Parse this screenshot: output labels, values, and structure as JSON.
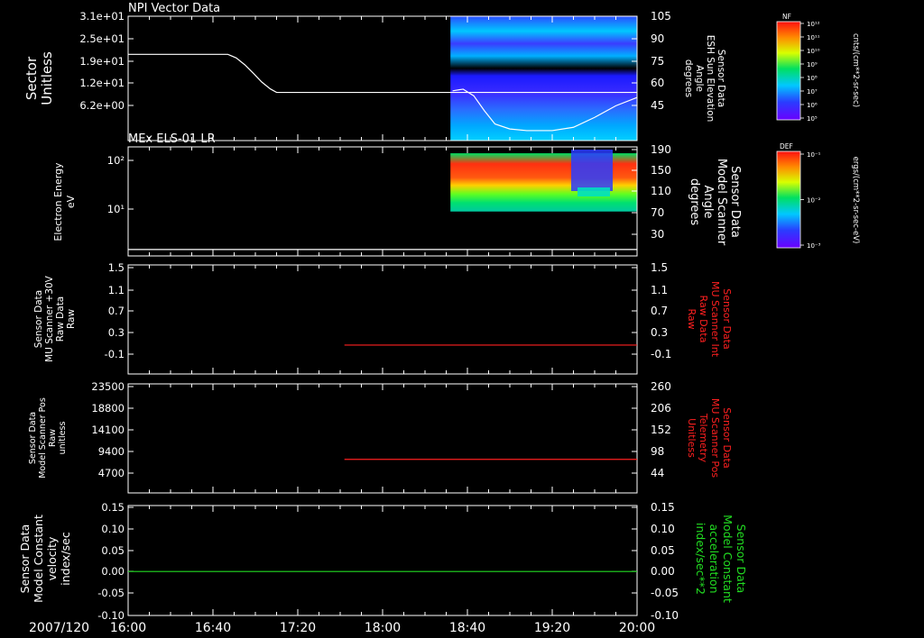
{
  "timeline": {
    "date": "2007/120",
    "ticks": [
      "16:00",
      "16:40",
      "17:20",
      "18:00",
      "18:40",
      "19:20",
      "20:00"
    ],
    "start_min": 960,
    "end_min": 1200
  },
  "colors": {
    "background": "#000000",
    "axis": "#ffffff",
    "red_trace": "#ff2020",
    "green_trace": "#22dd22"
  },
  "chart_data": [
    {
      "type": "line",
      "title": "NPI Vector Data",
      "ylabel": [
        "Sector",
        "Unitless"
      ],
      "yticks": [
        "3.1e+01",
        "2.5e+01",
        "1.9e+01",
        "1.2e+01",
        "6.2e+00"
      ],
      "ylim": [
        0,
        31
      ],
      "x": [
        960,
        1007,
        1011,
        1015,
        1019,
        1023,
        1027,
        1030,
        1200
      ],
      "y": [
        21.5,
        21.5,
        20.6,
        18.9,
        16.8,
        14.6,
        12.9,
        12.0,
        12.0
      ],
      "right_ylabel": [
        "Sensor Data",
        "ESH Sun Elevation",
        "Angle",
        "degrees"
      ],
      "right_yticks": [
        "105",
        "90",
        "75",
        "60",
        "45"
      ],
      "right_ylim": [
        30,
        105
      ],
      "right_series": {
        "x": [
          1113,
          1118,
          1123,
          1128,
          1133,
          1140,
          1148,
          1160,
          1170,
          1180,
          1190,
          1200
        ],
        "y": [
          60,
          61,
          57,
          48,
          40,
          37,
          36,
          36,
          38,
          44,
          51,
          56
        ]
      },
      "spectrogram_time_range": [
        1112,
        1200
      ],
      "color_scale": {
        "label": "NF",
        "units": "cnts/(cm**2-sr-sec)",
        "ticks": [
          "10¹²",
          "10¹¹",
          "10¹⁰",
          "10⁹",
          "10⁸",
          "10⁷",
          "10⁶",
          "10⁵"
        ]
      }
    },
    {
      "type": "line",
      "title": "MEx ELS-01 LR",
      "ylabel": [
        "Electron Energy",
        "eV"
      ],
      "yticks": [
        "10²",
        "10¹"
      ],
      "log_scale": true,
      "ylim": [
        1.5,
        200
      ],
      "x": [
        960,
        1200
      ],
      "y": [
        2.0,
        2.0
      ],
      "right_ylabel": [
        "Sensor Data",
        "Model Scanner",
        "Angle",
        "degrees"
      ],
      "right_yticks": [
        "190",
        "150",
        "110",
        "70",
        "30"
      ],
      "right_ylim": [
        8,
        190
      ],
      "spectrogram_time_range": [
        1112,
        1200
      ],
      "spectrogram_energy_range": [
        11,
        150
      ],
      "color_scale": {
        "label": "DEF",
        "units": "ergs/(cm**2-sr-sec-eV)",
        "ticks": [
          "10⁻¹",
          "10⁻²",
          "10⁻³"
        ]
      }
    },
    {
      "type": "line",
      "ylabel": [
        "Sensor Data",
        "MU Scanner +30V",
        "Raw Data",
        "Raw"
      ],
      "yticks": [
        "1.5",
        "1.1",
        "0.7",
        "0.3",
        "-0.1"
      ],
      "ylim": [
        -0.5,
        1.5
      ],
      "right_yticks": [
        "1.5",
        "1.1",
        "0.7",
        "0.3",
        "-0.1"
      ],
      "right_ylabel": [
        "Sensor Data",
        "MU Scanner Int",
        "Raw Data",
        "Raw"
      ],
      "series": [
        {
          "name": "Sensor Data MU Scanner Int Raw Data Raw",
          "color": "#ff2020",
          "x": [
            1062,
            1200
          ],
          "y": [
            0.03,
            0.03
          ]
        }
      ]
    },
    {
      "type": "line",
      "ylabel": [
        "Sensor Data",
        "Model Scanner Pos",
        "Raw",
        "unitless"
      ],
      "yticks": [
        "23500",
        "18800",
        "14100",
        "9400",
        "4700"
      ],
      "ylim": [
        0,
        23500
      ],
      "right_yticks": [
        "260",
        "206",
        "152",
        "98",
        "44"
      ],
      "right_ylabel": [
        "Sensor Data",
        "MU Scanner Pos",
        "Telemetry",
        "Unitless"
      ],
      "right_ylim": [
        0,
        260
      ],
      "series": [
        {
          "name": "Sensor Data MU Scanner Pos Telemetry Unitless",
          "color": "#ff2020",
          "axis": "right",
          "x": [
            1062,
            1200
          ],
          "y": [
            80,
            80
          ]
        }
      ]
    },
    {
      "type": "line",
      "ylabel": [
        "Sensor Data",
        "Model Constant",
        "velocity",
        "index/sec"
      ],
      "yticks": [
        "0.15",
        "0.10",
        "0.05",
        "0.00",
        "-0.05",
        "-0.10"
      ],
      "ylim": [
        -0.1,
        0.15
      ],
      "right_yticks": [
        "0.15",
        "0.10",
        "0.05",
        "0.00",
        "-0.05",
        "-0.10"
      ],
      "right_ylabel": [
        "Sensor Data",
        "Model Constant",
        "acceleration",
        "index/sec**2"
      ],
      "series": [
        {
          "name": "Sensor Data Model Constant acceleration index/sec**2",
          "color": "#22dd22",
          "x": [
            960,
            1200
          ],
          "y": [
            0.0,
            0.0
          ]
        }
      ]
    }
  ]
}
